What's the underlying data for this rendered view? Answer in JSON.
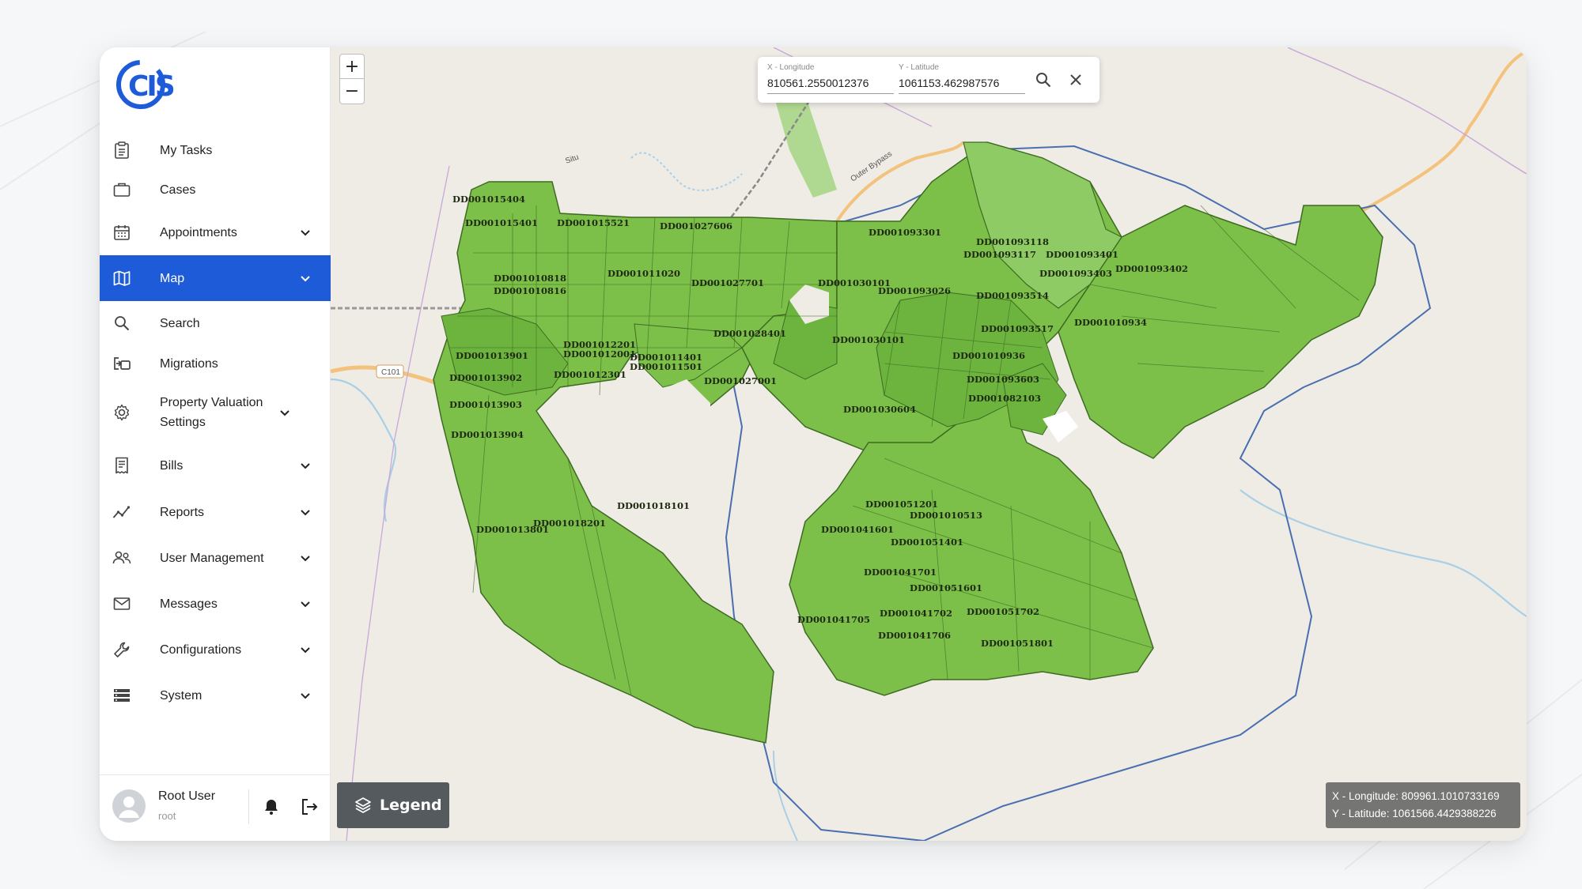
{
  "app": {
    "logo_text": "CIS",
    "brand_color": "#1d5bd8"
  },
  "sidebar": {
    "items": [
      {
        "label": "My Tasks",
        "icon": "clipboard-icon",
        "has_chevron": false
      },
      {
        "label": "Cases",
        "icon": "briefcase-icon",
        "has_chevron": false
      },
      {
        "label": "Appointments",
        "icon": "calendar-icon",
        "has_chevron": true
      },
      {
        "label": "Map",
        "icon": "map-icon",
        "has_chevron": true,
        "active": true
      },
      {
        "label": "Search",
        "icon": "search-icon",
        "has_chevron": false
      },
      {
        "label": "Migrations",
        "icon": "migrate-icon",
        "has_chevron": false
      },
      {
        "label": "Property Valuation Settings",
        "icon": "gear-icon",
        "has_chevron": true
      },
      {
        "label": "Bills",
        "icon": "receipt-icon",
        "has_chevron": true
      },
      {
        "label": "Reports",
        "icon": "chart-line-icon",
        "has_chevron": true
      },
      {
        "label": "User Management",
        "icon": "users-icon",
        "has_chevron": true
      },
      {
        "label": "Messages",
        "icon": "envelope-icon",
        "has_chevron": true
      },
      {
        "label": "Configurations",
        "icon": "wrench-icon",
        "has_chevron": true
      },
      {
        "label": "System",
        "icon": "server-icon",
        "has_chevron": true
      }
    ],
    "user": {
      "name": "Root User",
      "role": "root"
    }
  },
  "map": {
    "zoom_in": "+",
    "zoom_out": "−",
    "coord_search": {
      "x_label": "X - Longitude",
      "x_value": "810561.2550012376",
      "y_label": "Y - Latitude",
      "y_value": "1061153.462987576"
    },
    "legend_label": "Legend",
    "mouse_position": {
      "x": "X - Longitude: 809961.1010733169",
      "y": "Y - Latitude: 1061566.4429388226"
    },
    "road_labels": [
      "C101",
      "Outer Bypass",
      "Situ"
    ],
    "parcel_labels": [
      "DD001015404",
      "DD001015401",
      "DD001015521",
      "DD001027606",
      "DD001093301",
      "DD001093118",
      "DD001093117",
      "DD001093401",
      "DD001093403",
      "DD001093402",
      "DD001010818",
      "DD001010816",
      "DD001011020",
      "DD001027701",
      "DD001030101",
      "DD001093026",
      "DD001093514",
      "DD001093517",
      "DD001010934",
      "DD001028401",
      "DD001030101",
      "DD001012201",
      "DD001012001",
      "DD001013901",
      "DD001011401",
      "DD001011501",
      "DD001010936",
      "DD001013902",
      "DD001012301",
      "DD001027001",
      "DD001093603",
      "DD001013903",
      "DD001082103",
      "DD001030604",
      "DD001013904",
      "DD001018101",
      "DD001051201",
      "DD001010513",
      "DD001013801",
      "DD001018201",
      "DD001041601",
      "DD001051401",
      "DD001041701",
      "DD001051601",
      "DD001041705",
      "DD001041702",
      "DD001051702",
      "DD001041706",
      "DD001051801"
    ],
    "colors": {
      "parcel_fill": "#7cc04a",
      "parcel_stroke": "#3e6b22",
      "boundary": "#4a6fb0",
      "road": "#f3c27d",
      "water": "#a9cfe6"
    }
  }
}
